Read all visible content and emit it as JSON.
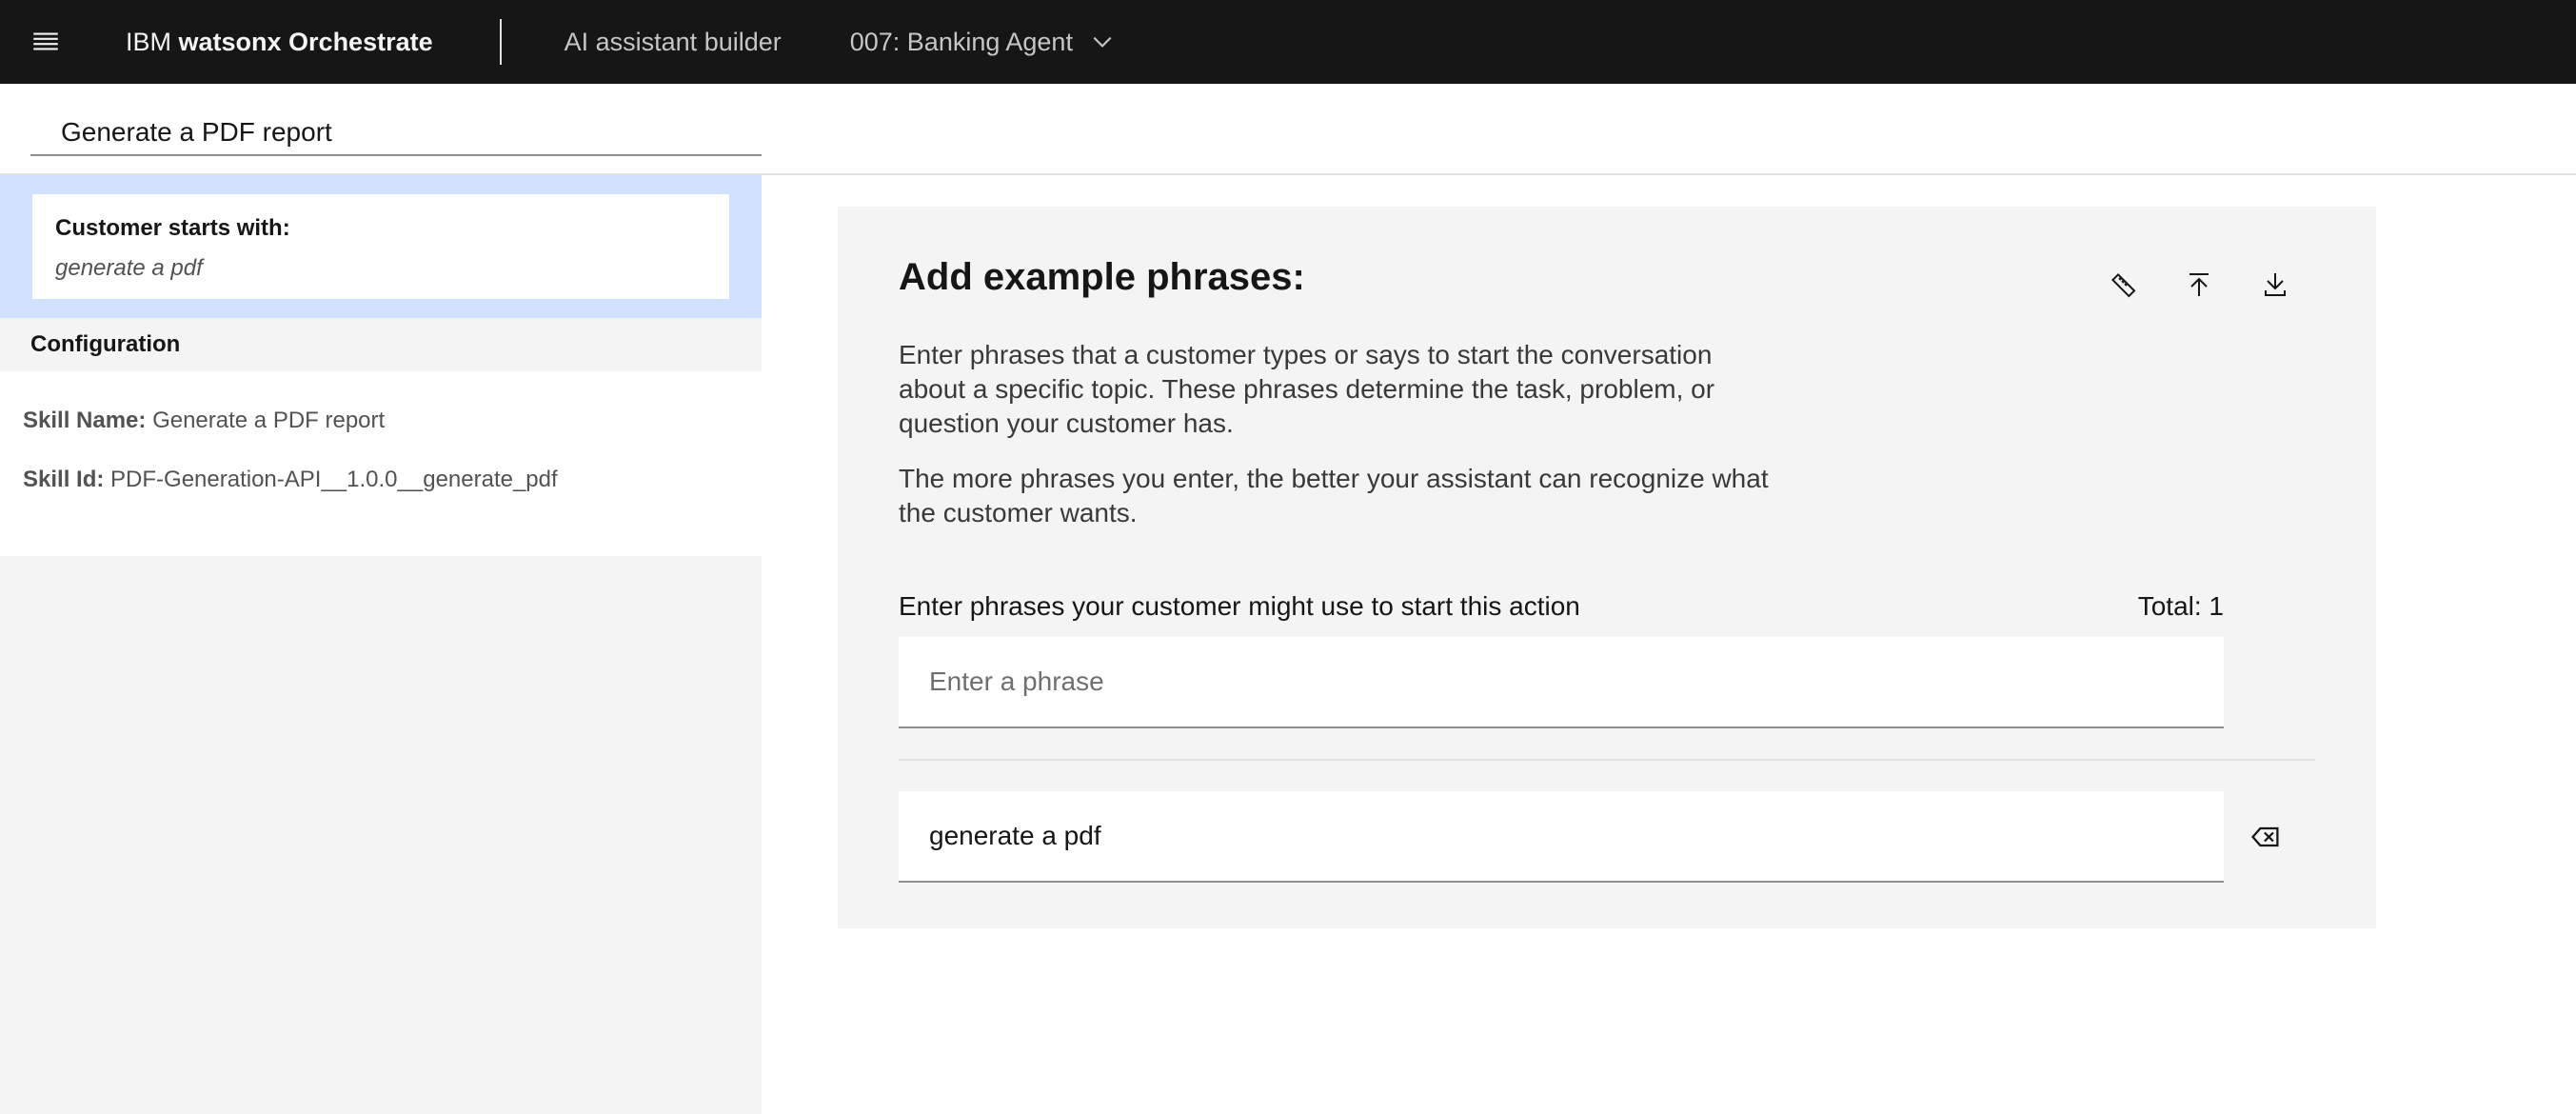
{
  "header": {
    "brand_prefix": "IBM ",
    "brand_name": "watsonx Orchestrate",
    "nav_label": "AI assistant builder",
    "agent_selector": "007: Banking Agent"
  },
  "title_input": {
    "value": "Generate a PDF report"
  },
  "left_panel": {
    "starts_title": "Customer starts with:",
    "starts_phrase": "generate a pdf",
    "config_header": "Configuration",
    "skill_name_key": "Skill Name:",
    "skill_name_value": "Generate a PDF report",
    "skill_id_key": "Skill Id:",
    "skill_id_value": "PDF-Generation-API__1.0.0__generate_pdf"
  },
  "main": {
    "title": "Add example phrases:",
    "desc1": "Enter phrases that a customer types or says to start the conversation about a specific topic. These phrases determine the task, problem, or question your customer has.",
    "desc2": "The more phrases you enter, the better your assistant can recognize what the customer wants.",
    "input_label": "Enter phrases your customer might use to start this action",
    "total": "Total: 1",
    "input_placeholder": "Enter a phrase",
    "phrases": [
      "generate a pdf"
    ],
    "icons": [
      "ruler-icon",
      "upload-icon",
      "download-icon",
      "delete-icon"
    ]
  }
}
